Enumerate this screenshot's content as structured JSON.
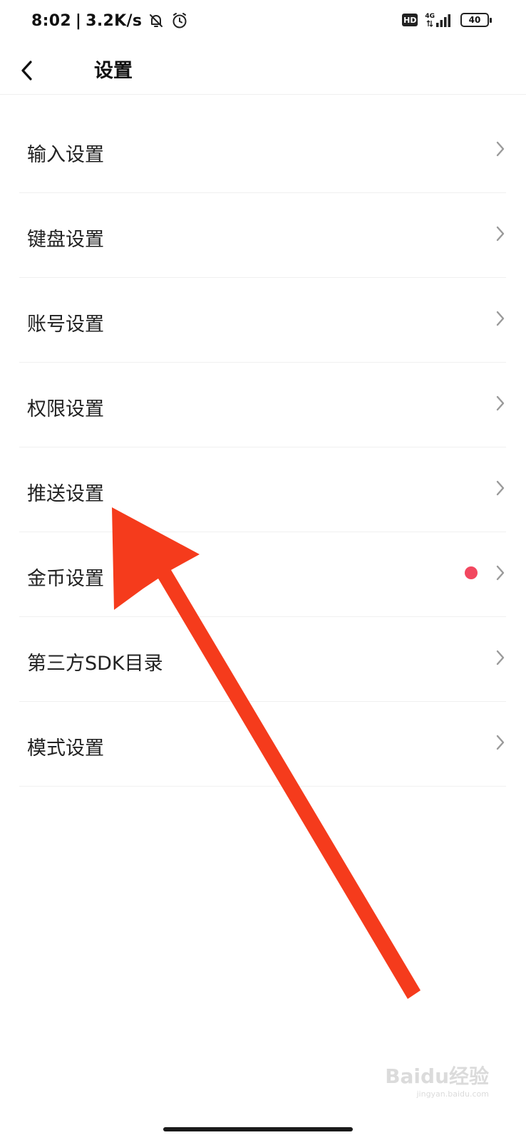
{
  "status_bar": {
    "time": "8:02",
    "separator": "|",
    "net_speed": "3.2K/s",
    "network_type": "4G",
    "hd_label": "HD",
    "battery_level": "40"
  },
  "header": {
    "title": "设置"
  },
  "settings": {
    "items": [
      {
        "label": "输入设置",
        "has_dot": false
      },
      {
        "label": "键盘设置",
        "has_dot": false
      },
      {
        "label": "账号设置",
        "has_dot": false
      },
      {
        "label": "权限设置",
        "has_dot": false
      },
      {
        "label": "推送设置",
        "has_dot": false
      },
      {
        "label": "金币设置",
        "has_dot": true
      },
      {
        "label": "第三方SDK目录",
        "has_dot": false
      },
      {
        "label": "模式设置",
        "has_dot": false
      }
    ]
  },
  "colors": {
    "dot": "#f2475f",
    "arrow": "#f53b1c",
    "chevron": "#9a9a9a"
  },
  "watermark": {
    "logo_text": "Baidu经验",
    "sub_text": "jingyan.baidu.com"
  }
}
